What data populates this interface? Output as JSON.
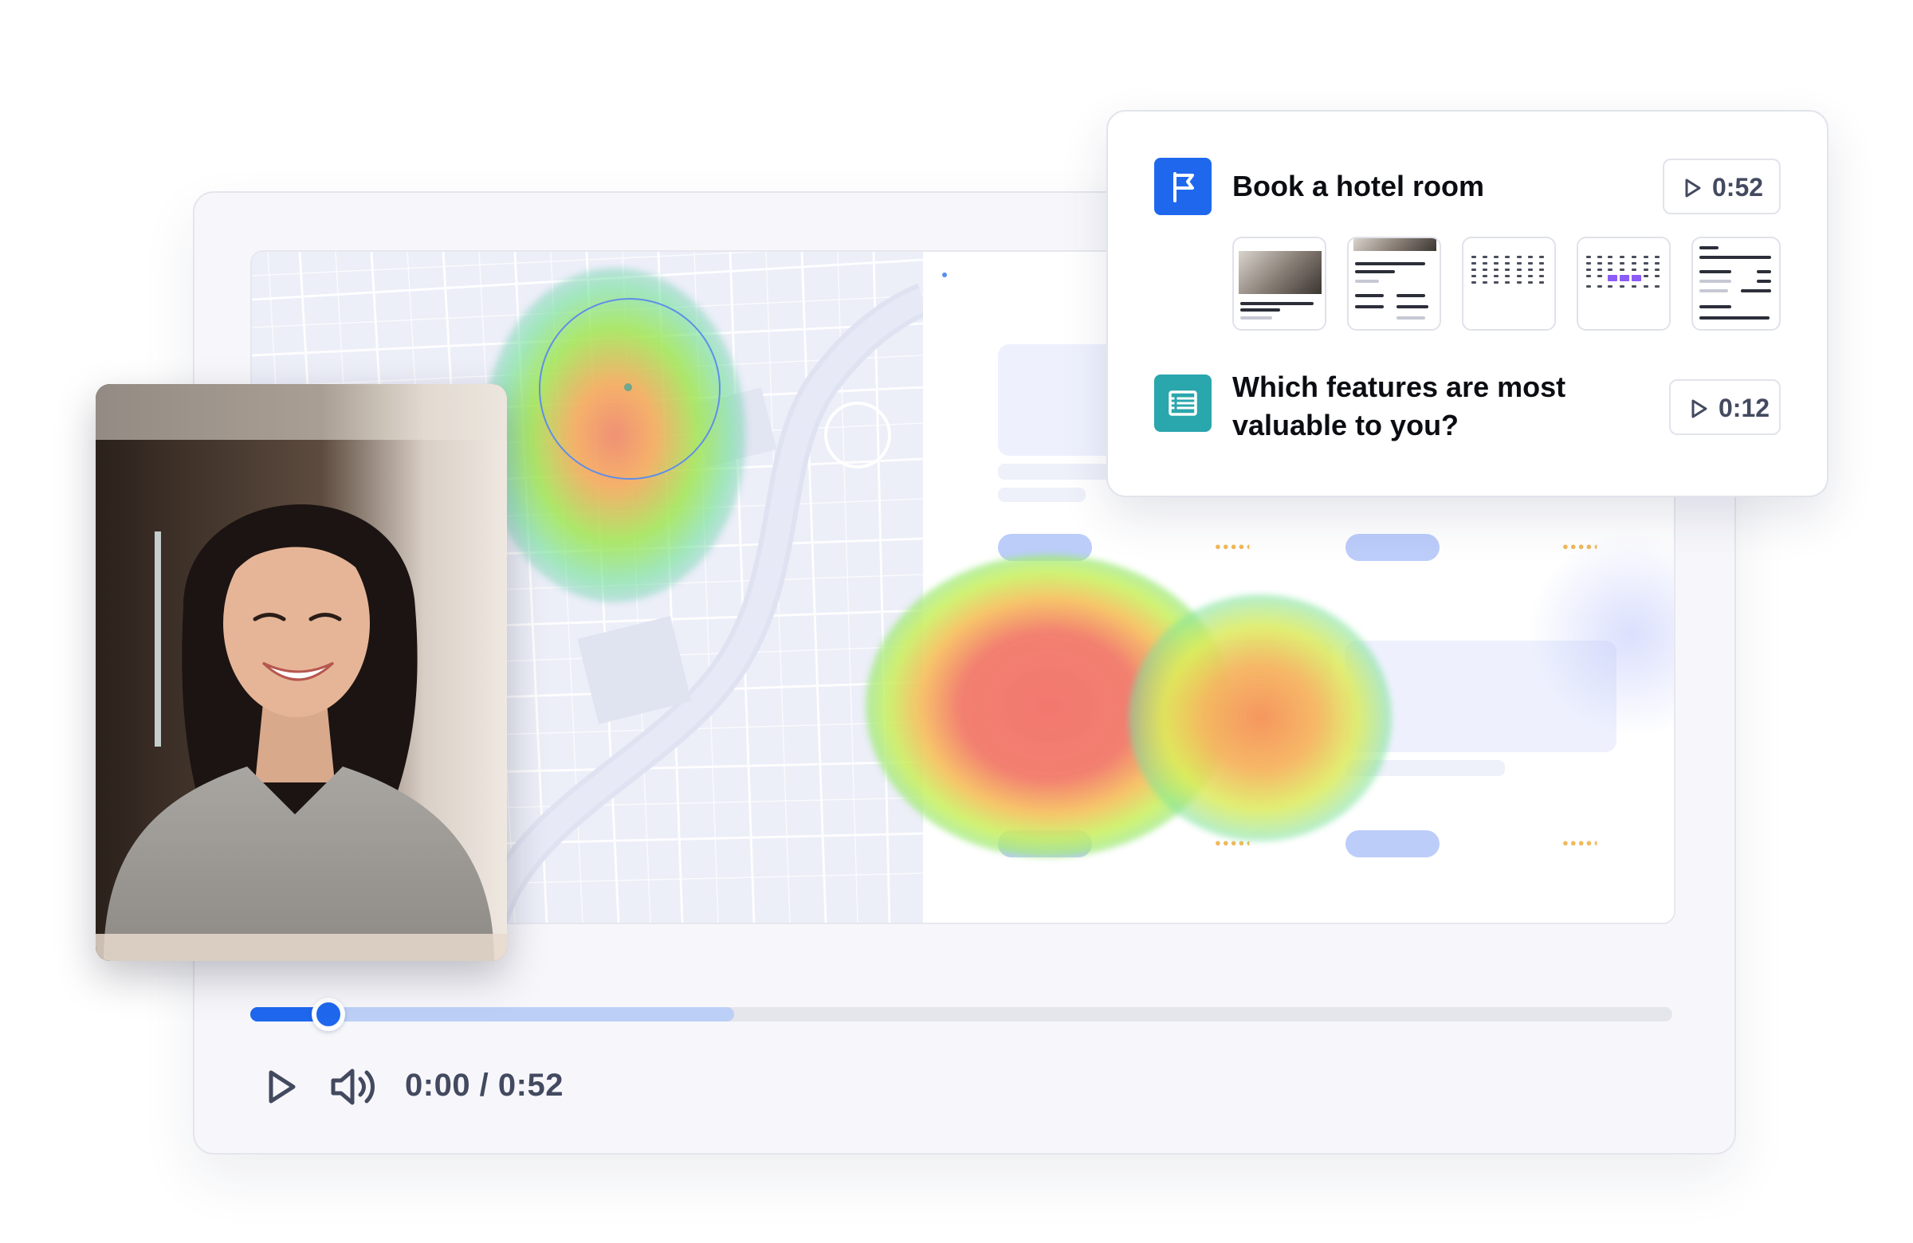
{
  "player": {
    "time_readout": "0:00 / 0:52",
    "played_fraction": 0.055,
    "buffered_fraction": 0.34
  },
  "tasks": [
    {
      "title": "Book a hotel room",
      "duration": "0:52",
      "icon": "flag-icon",
      "icon_color": "#1f68ee"
    },
    {
      "title_line1": "Which features are most",
      "title_line2": "valuable to you?",
      "duration": "0:12",
      "icon": "list-icon",
      "icon_color": "#2aa6ad"
    }
  ],
  "colors": {
    "accent": "#1f68ee",
    "teal": "#2aa6ad",
    "heat_hot": "#f08070",
    "heat_warm": "#f5c35a",
    "heat_cool": "#7be28a"
  }
}
